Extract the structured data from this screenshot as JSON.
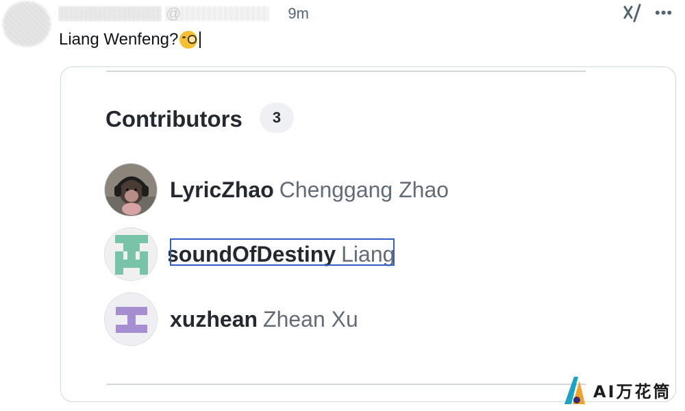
{
  "tweet": {
    "author_name": "",
    "at_symbol": "@",
    "time": "9m",
    "text": "Liang Wenfeng?",
    "emoji": "face-with-monocle"
  },
  "contributors": {
    "title": "Contributors",
    "count": "3",
    "items": [
      {
        "login": "LyricZhao",
        "name": "Chenggang Zhao",
        "avatar": "monkey-with-headphones"
      },
      {
        "login": "soundOfDestiny",
        "name": "Liang",
        "avatar": "teal-identicon",
        "accent": "#79c4a8"
      },
      {
        "login": "xuzhean",
        "name": "Zhean Xu",
        "avatar": "purple-identicon",
        "accent": "#a58fd1"
      }
    ]
  },
  "watermark": {
    "text": "AI万花筒"
  },
  "colors": {
    "selection": "#2f5fc4",
    "link_text": "#24292f",
    "secondary_text": "#636c76"
  }
}
